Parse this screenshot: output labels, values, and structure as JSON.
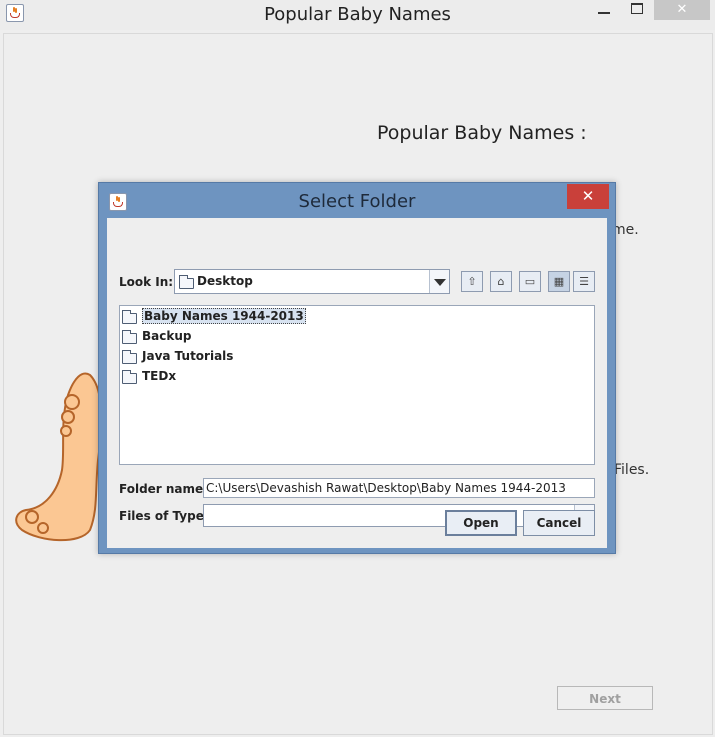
{
  "main_window": {
    "title": "Popular Baby Names",
    "heading": "Popular Baby Names :",
    "partial_text_1": "me.",
    "partial_text_2": "Files.",
    "next_button": "Next"
  },
  "dialog": {
    "title": "Select Folder",
    "look_in_label": "Look In:",
    "look_in_value": "Desktop",
    "toolbar_icons": [
      "up-one-level-icon",
      "home-icon",
      "new-folder-icon",
      "list-view-icon",
      "details-view-icon"
    ],
    "files": [
      {
        "name": "Baby Names 1944-2013",
        "selected": true
      },
      {
        "name": "Backup",
        "selected": false
      },
      {
        "name": "Java Tutorials",
        "selected": false
      },
      {
        "name": "TEDx",
        "selected": false
      }
    ],
    "folder_name_label": "Folder name:",
    "folder_name_value": "C:\\Users\\Devashish Rawat\\Desktop\\Baby Names 1944-2013",
    "files_of_type_label": "Files of Type:",
    "files_of_type_value": "",
    "open_button": "Open",
    "cancel_button": "Cancel"
  },
  "colors": {
    "dialog_frame": "#6e94c0",
    "close_red": "#c9403a",
    "selection": "#d7e2f0"
  }
}
